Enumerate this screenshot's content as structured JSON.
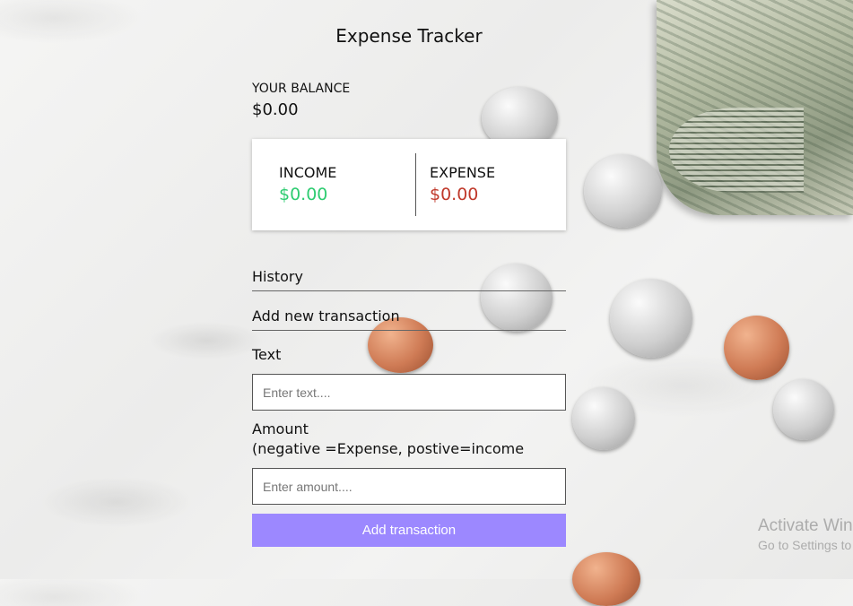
{
  "app": {
    "title": "Expense Tracker"
  },
  "balance": {
    "label": "YOUR BALANCE",
    "value": "$0.00"
  },
  "summary": {
    "income_label": "INCOME",
    "income_value": "$0.00",
    "expense_label": "EXPENSE",
    "expense_value": "$0.00"
  },
  "history": {
    "heading": "History"
  },
  "form": {
    "heading": "Add new transaction",
    "text_label": "Text",
    "text_placeholder": "Enter text....",
    "amount_label": "Amount",
    "amount_hint": "(negative =Expense, postive=income",
    "amount_placeholder": "Enter amount....",
    "submit_label": "Add transaction"
  },
  "watermark": {
    "line1": "Activate Win",
    "line2": "Go to Settings to"
  },
  "colors": {
    "income": "#2ecc71",
    "expense": "#c0392b",
    "button": "#9c88ff"
  }
}
